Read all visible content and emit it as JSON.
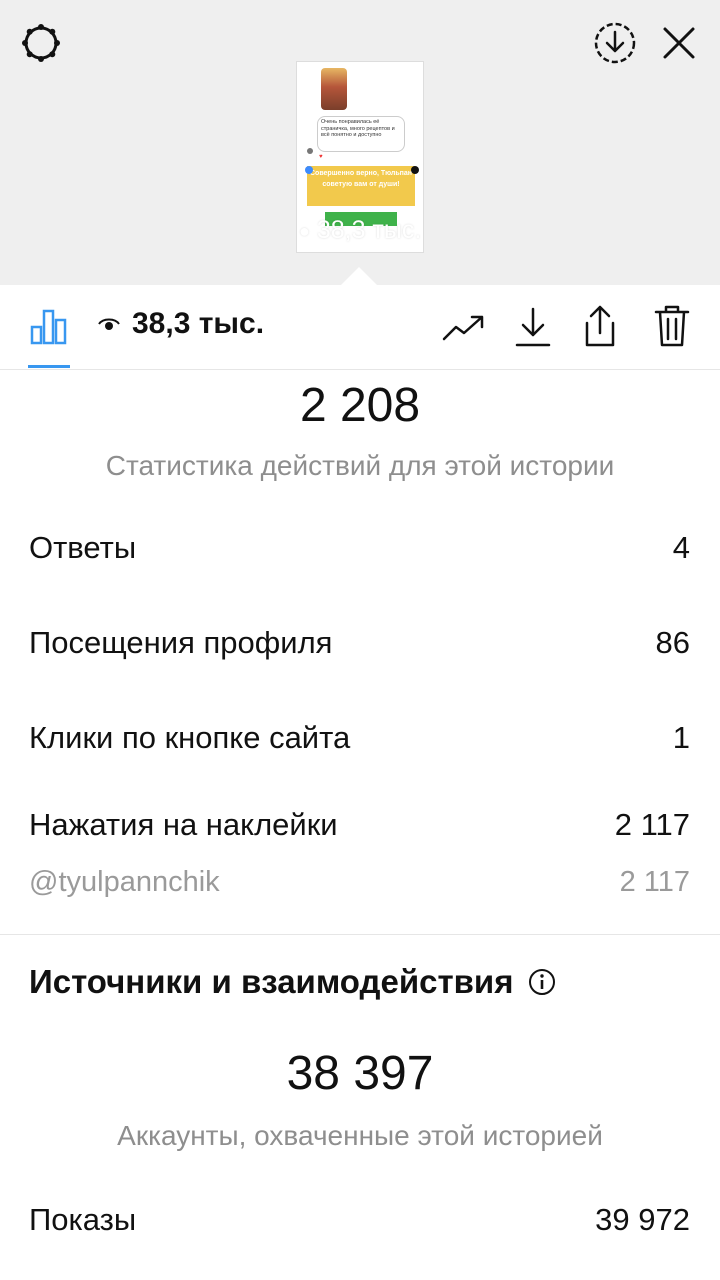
{
  "preview": {
    "views_overlay": "38,3 тыс.",
    "bubble_text": "Очень понравилась её страничка, много рецептов и всё понятно и доступно",
    "sticker_text": "Совершенно верно, Тюльпан советую вам от души!"
  },
  "toolbar": {
    "views_label": "38,3 тыс."
  },
  "actions": {
    "total": "2 208",
    "caption": "Статистика действий для этой истории",
    "rows": [
      {
        "label": "Ответы",
        "value": "4"
      },
      {
        "label": "Посещения профиля",
        "value": "86"
      },
      {
        "label": "Клики по кнопке сайта",
        "value": "1"
      },
      {
        "label": "Нажатия на наклейки",
        "value": "2 117"
      }
    ],
    "sticker_row": {
      "label": "@tyulpannchik",
      "value": "2 117"
    }
  },
  "reach": {
    "title": "Источники и взаимодействия",
    "total": "38 397",
    "caption": "Аккаунты, охваченные этой историей",
    "impressions": {
      "label": "Показы",
      "value": "39 972"
    }
  },
  "colors": {
    "accent": "#3897f0",
    "background_top": "#efefef"
  }
}
